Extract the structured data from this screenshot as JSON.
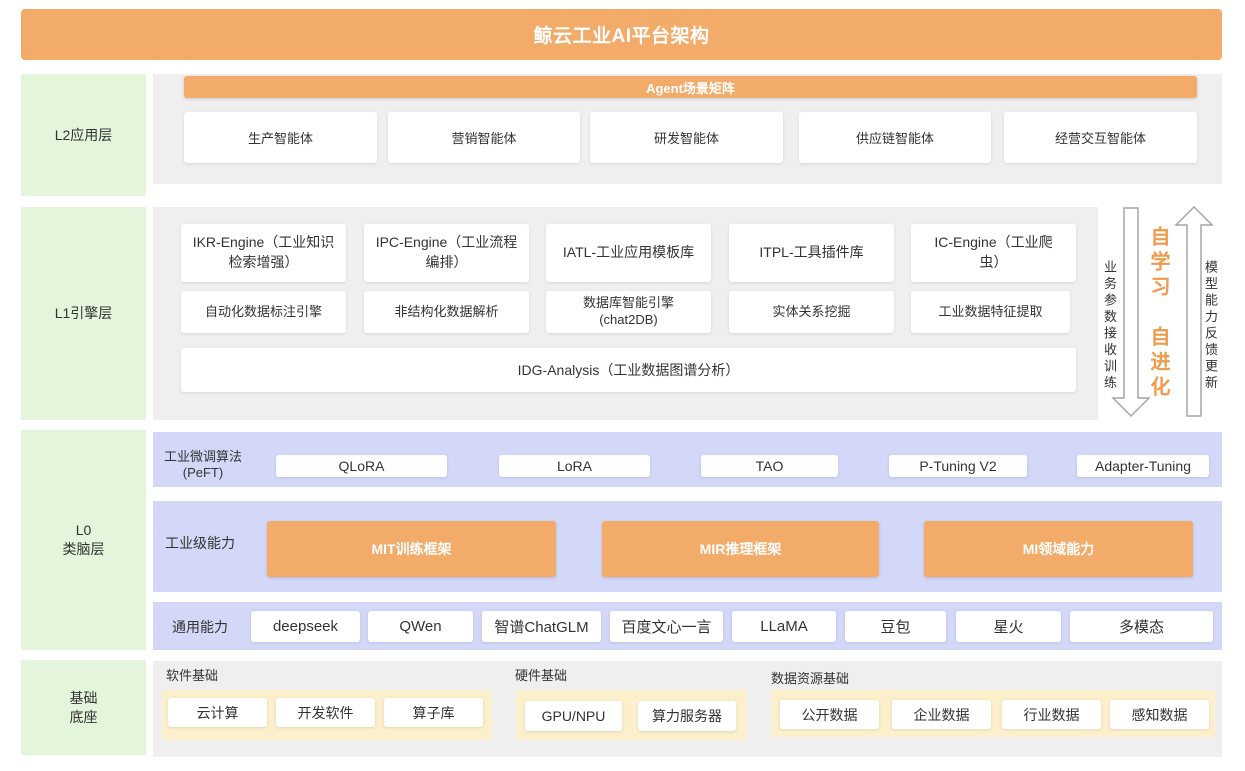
{
  "title": "鲸云工业AI平台架构",
  "colors": {
    "orange": "#F2AB69",
    "green": "#E3F5DB",
    "gray": "#EFEFEF",
    "lavender": "#D4D8F8",
    "beige": "#FBF0CB",
    "accent": "#EF9B4B",
    "text": "#333333"
  },
  "l2": {
    "label": "L2应用层",
    "header": "Agent场景矩阵",
    "agents": [
      "生产智能体",
      "营销智能体",
      "研发智能体",
      "供应链智能体",
      "经营交互智能体"
    ]
  },
  "l1": {
    "label": "L1引擎层",
    "engines": [
      "IKR-Engine（工业知识\n检索增强）",
      "IPC-Engine（工业流程\n编排）",
      "IATL-工业应用模板库",
      "ITPL-工具插件库",
      "IC-Engine（工业爬\n虫）"
    ],
    "modules": [
      "自动化数据标注引擎",
      "非结构化数据解析",
      "数据库智能引擎\n(chat2DB)",
      "实体关系挖掘",
      "工业数据特征提取"
    ],
    "analysis": "IDG-Analysis（工业数据图谱分析）",
    "loop": {
      "down": "业务参数接收训练",
      "self_learn": "自学习",
      "self_evolve": "自进化",
      "up": "模型能力反馈更新"
    }
  },
  "l0": {
    "label": "L0\n类脑层",
    "peft": {
      "label": "工业微调算法\n(PeFT)",
      "items": [
        "QLoRA",
        "LoRA",
        "TAO",
        "P-Tuning V2",
        "Adapter-Tuning"
      ]
    },
    "industrial": {
      "label": "工业级能力",
      "items": [
        "MIT训练框架",
        "MIR推理框架",
        "MI领域能力"
      ]
    },
    "general": {
      "label": "通用能力",
      "items": [
        "deepseek",
        "QWen",
        "智谱ChatGLM",
        "百度文心一言",
        "LLaMA",
        "豆包",
        "星火",
        "多模态"
      ]
    }
  },
  "base": {
    "label": "基础\n底座",
    "software": {
      "label": "软件基础",
      "items": [
        "云计算",
        "开发软件",
        "算子库"
      ]
    },
    "hardware": {
      "label": "硬件基础",
      "items": [
        "GPU/NPU",
        "算力服务器"
      ]
    },
    "data": {
      "label": "数据资源基础",
      "items": [
        "公开数据",
        "企业数据",
        "行业数据",
        "感知数据"
      ]
    }
  }
}
